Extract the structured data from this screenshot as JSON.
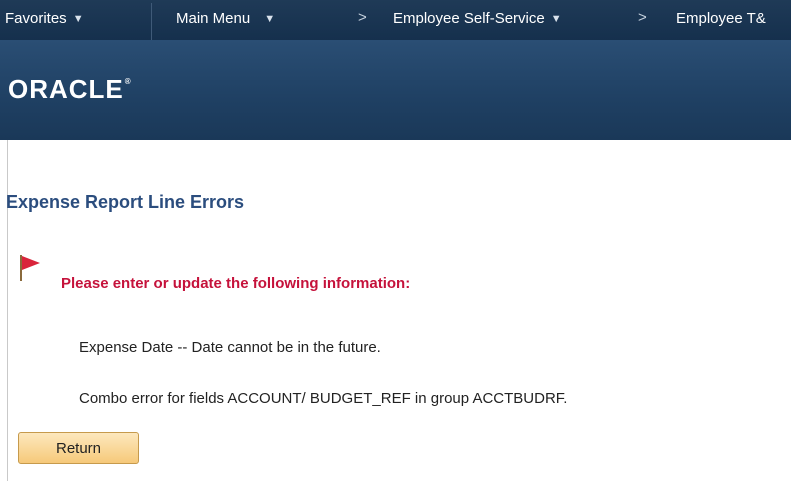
{
  "nav": {
    "favorites": "Favorites",
    "main_menu": "Main Menu",
    "breadcrumb_1": "Employee Self-Service",
    "breadcrumb_2": "Employee T&"
  },
  "brand": {
    "logo_text": "ORACLE",
    "trademark": "®"
  },
  "page": {
    "title": "Expense Report Line Errors",
    "error_heading": "Please enter or update the following information:",
    "messages": [
      "Expense Date -- Date cannot be in the future.",
      "Combo error for fields ACCOUNT/ BUDGET_REF in group ACCTBUDRF."
    ],
    "return_label": "Return"
  },
  "colors": {
    "nav_bg": "#1f3a57",
    "header_bg": "#244a6f",
    "title": "#2b4d7e",
    "error": "#c5123b",
    "flag": "#d9243b",
    "button_bg": "#f8d08a"
  },
  "icons": {
    "flag": "error-flag-icon",
    "dropdown": "triangle-down-icon",
    "separator": "chevron-right-icon"
  }
}
